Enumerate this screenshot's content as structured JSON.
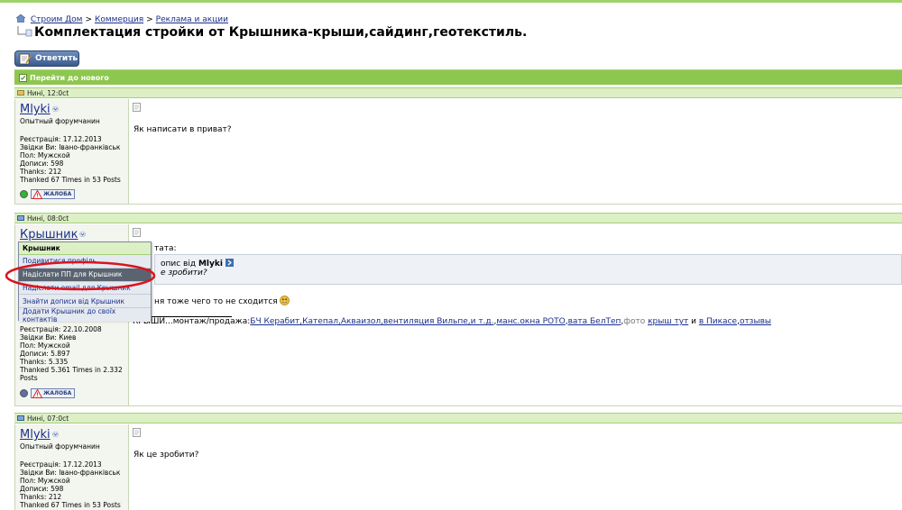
{
  "breadcrumb": {
    "items": [
      "Строим Дом",
      "Коммерция",
      "Реклама и акции"
    ],
    "separator": ">"
  },
  "thread_title": "Комплектация стройки от Крышника-крыши,сайдинг,геотекстиль.",
  "reply_button_label": "Ответить",
  "goto_new_label": "Перейти до нового",
  "colors": {
    "accent_green": "#8ec74f",
    "link_blue": "#1a2f8a",
    "highlight_red": "#d9141c"
  },
  "posts": [
    {
      "time": "Нині, 12:0ct",
      "user": "Mlyki",
      "user_title": "Опытный форумчанин",
      "stats": [
        "Реєстрація: 17.12.2013",
        "Звідки Ви: Івано-франківськ",
        "Пол: Мужской",
        "Дописи: 598",
        "Thanks: 212",
        "Thanked 67 Times in 53 Posts"
      ],
      "status": "online",
      "report_label": "ЖАЛОБА",
      "message": "Як написати в приват?"
    },
    {
      "time": "Нині, 08:0ct",
      "user": "Крышник",
      "stats": [
        "Реєстрація: 22.10.2008",
        "Звідки Ви: Киев",
        "Пол: Мужской",
        "Дописи: 5.897",
        "Thanks: 5.335",
        "Thanked 5.361 Times in 2.332 Posts"
      ],
      "status": "offline",
      "report_label": "ЖАЛОБА",
      "quote_label": "тата:",
      "quote_from_prefix": "опис від",
      "quote_from_user": "Mlyki",
      "quote_text": "е зробити?",
      "message": "ня тоже чего то не сходится",
      "signature": {
        "prefix": "КРЫШИ...монтаж/продажа:",
        "links": [
          "БЧ Керабит,Катепал,Акваизол,вентиляция Вильпе,и т.д.",
          "манс.окна РОТО",
          "вата БелТеп"
        ],
        "text_foto": "фото",
        "link_krysh": "крыш тут",
        "text_and": " и ",
        "link_picasa": "в Пикасе",
        "link_reviews": "отзывы"
      }
    },
    {
      "time": "Нині, 07:0ct",
      "user": "Mlyki",
      "user_title": "Опытный форумчанин",
      "stats": [
        "Реєстрація: 17.12.2013",
        "Звідки Ви: Івано-франківськ",
        "Пол: Мужской",
        "Дописи: 598",
        "Thanks: 212",
        "Thanked 67 Times in 53 Posts"
      ],
      "message": "Як це зробити?"
    }
  ],
  "user_menu": {
    "title": "Крышник",
    "items": [
      "Подивитися профіль",
      "Надіслати ПП для Крышник",
      "Надіслати email для Крышник",
      "Знайти дописи від Крышник",
      "Додати Крышник до своїх контактів"
    ],
    "highlighted_index": 1
  }
}
